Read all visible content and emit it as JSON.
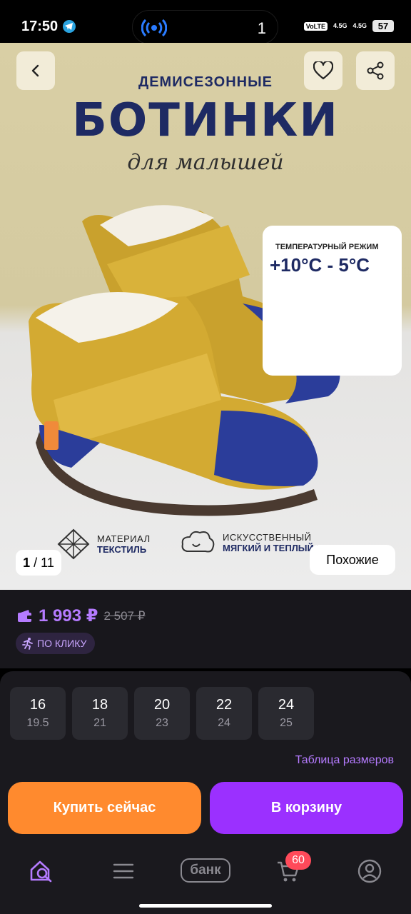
{
  "status_bar": {
    "time": "17:50",
    "island_count": "1",
    "volte": "VoLTE",
    "net1": "4.5G",
    "net2": "4.5G",
    "battery": "57"
  },
  "banner": {
    "subtitle": "ДЕМИСЕЗОННЫЕ",
    "title": "БОТИНКИ",
    "script": "для малышей",
    "temp_label": "ТЕМПЕРАТУРНЫЙ РЕЖИМ",
    "temp_value": "+10°C - 5°C",
    "feature1_line1": "МАТЕРИАЛ",
    "feature1_line2": "ТЕКСТИЛЬ",
    "feature2_line1": "ИСКУССТВЕННЫЙ",
    "feature2_line2": "МЯГКИЙ И ТЕПЛЫЙ МЕХ",
    "counter_current": "1",
    "counter_total": "/ 11",
    "similar_label": "Похожие"
  },
  "price": {
    "current": "1 993 ₽",
    "old": "2 507 ₽",
    "promo": "ПО КЛИКУ"
  },
  "sizes": {
    "items": [
      {
        "size": "16",
        "length": "19.5"
      },
      {
        "size": "18",
        "length": "21"
      },
      {
        "size": "20",
        "length": "23"
      },
      {
        "size": "22",
        "length": "24"
      },
      {
        "size": "24",
        "length": "25"
      }
    ],
    "table_link": "Таблица размеров"
  },
  "actions": {
    "buy_now": "Купить сейчас",
    "add_to_cart": "В корзину"
  },
  "navbar": {
    "bank_label": "банк",
    "cart_count": "60"
  },
  "colors": {
    "accent_purple": "#9b30ff",
    "accent_orange": "#ff8a2e",
    "price_purple": "#b57bff",
    "badge_red": "#ff4a5a"
  },
  "icons": [
    "back-icon",
    "heart-icon",
    "share-icon",
    "wallet-icon",
    "runner-icon",
    "home-search-icon",
    "menu-icon",
    "cart-icon",
    "profile-icon",
    "telegram-icon",
    "hotspot-icon"
  ]
}
